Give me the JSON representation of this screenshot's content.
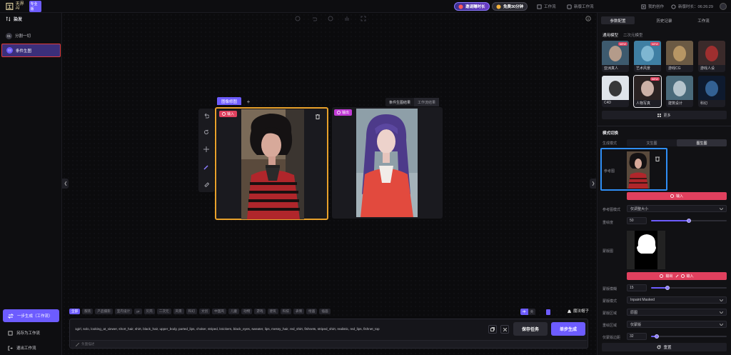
{
  "header": {
    "logo_text": "无界AI",
    "logo_badge": "专业版",
    "invite_label": "邀请赚时长",
    "free_label": "免费30分钟",
    "workflow_label": "工作流",
    "new_workflow_label": "新版工作流",
    "my_works_label": "我的创作",
    "new_duration_label": "新版时长：06:26:29"
  },
  "sidebar": {
    "title": "染发",
    "items": [
      {
        "num": "01",
        "label": "分割一切"
      },
      {
        "num": "02",
        "label": "条件生图"
      }
    ],
    "generate_label": "一步生成（工作流）",
    "save_workflow_label": "另存为工作流",
    "exit_workflow_label": "退出工作流"
  },
  "canvas": {
    "group_tab": "图像修图",
    "add_tab": "+",
    "input_tag": "输入",
    "output_tag": "输出",
    "result_tabs": [
      "条件生图结果",
      "工作流结果"
    ]
  },
  "prompt": {
    "chips": [
      "全部",
      "服装",
      "产品摄影",
      "室内设计",
      "IP",
      "贝壳",
      "二次元",
      "风景",
      "科幻",
      "文创",
      "中国风",
      "儿童",
      "动物",
      "游戏",
      "建筑",
      "科技",
      "表情",
      "绘画",
      "插画"
    ],
    "active_chip": "全部",
    "toggle_on": "中",
    "toggle_off": "英",
    "toggle_right": "魔法帽子",
    "text": "1girl, solo, looking_at_viewer, short_hair, shirt, black_hair, upper_body, parted_lips, choker, striped, knickers, black_eyes, sweater, lips, messy_hair, red_shirt, fishnets, striped_shirt, realistic, red_lips, fishnet_top",
    "negative_placeholder": "负面描述",
    "save_task_label": "保存任务",
    "generate_label": "单步生成"
  },
  "right_panel": {
    "tabs": [
      "参数配置",
      "历史记录",
      "工作流"
    ],
    "model_tabs": [
      "通用模型",
      "二次元模型"
    ],
    "models": [
      {
        "label": "亚洲真人",
        "tag": "NEW"
      },
      {
        "label": "艺术风景",
        "tag": "NEW"
      },
      {
        "label": "游戏CG",
        "tag": ""
      },
      {
        "label": "游戏人设",
        "tag": ""
      },
      {
        "label": "C4D",
        "tag": ""
      },
      {
        "label": "人物写真",
        "tag": "NEW"
      },
      {
        "label": "建筑设计",
        "tag": ""
      },
      {
        "label": "科幻",
        "tag": ""
      }
    ],
    "more_label": "更多",
    "mode_title": "模式切换",
    "mode_label": "生成模式",
    "mode_options": [
      "文生图",
      "图生图"
    ],
    "reference_label": "参考图",
    "input_button": "输入",
    "ref_mode_label": "参考图模式",
    "ref_mode_value": "仅调整大小",
    "denoise_label": "重绘度",
    "denoise_value": "50",
    "denoise_fraction": 0.5,
    "mask_label": "蒙版图",
    "mask_output": "输出",
    "mask_input": "输入",
    "mask_blur_label": "蒙版模糊",
    "mask_blur_value": "15",
    "mask_blur_fraction": 0.22,
    "mask_mode_label": "蒙版模式",
    "mask_mode_value": "Inpaint Masked",
    "fill_label": "蒙版区域",
    "fill_value": "原图",
    "area_label": "重绘区域",
    "area_value": "仅蒙版",
    "padding_label": "仅蒙版边距",
    "padding_value": "32",
    "padding_fraction": 0.08,
    "reset_label": "重置"
  }
}
